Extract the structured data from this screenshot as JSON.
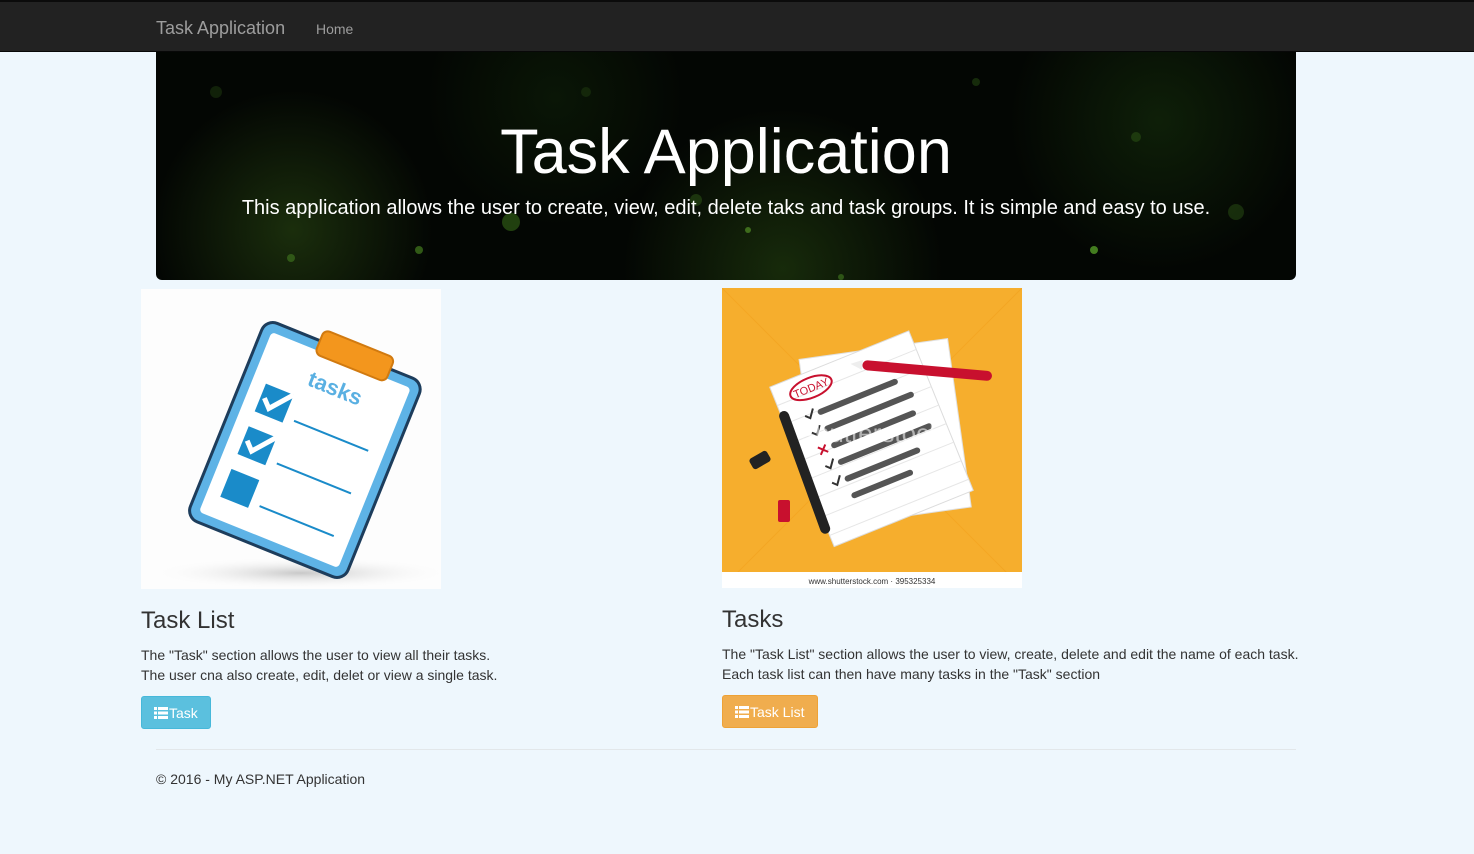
{
  "navbar": {
    "brand": "Task Application",
    "links": [
      {
        "label": "Home"
      }
    ]
  },
  "jumbotron": {
    "title": "Task Application",
    "lead": "This application allows the user to create, view, edit, delete taks and task groups. It is simple and easy to use."
  },
  "sections": [
    {
      "image_icon": "clipboard-tasks-illustration",
      "image_text": "tasks",
      "title": "Task List",
      "lines": [
        "The \"Task\" section allows the user to view all their tasks.",
        "The user cna also create, edit, delet or view a single task."
      ],
      "button_label": "Task",
      "button_icon": "list-icon",
      "button_color": "#5bc0de"
    },
    {
      "image_icon": "paper-checklist-illustration",
      "image_text": "TODAY",
      "image_watermark": "shutterstock",
      "image_caption": "www.shutterstock.com · 395325334",
      "title": "Tasks",
      "lines": [
        "The \"Task List\" section allows the user to view, create, delete and edit the name of each task.",
        "Each task list can then have many tasks in the \"Task\" section"
      ],
      "button_label": "Task List",
      "button_icon": "list-icon",
      "button_color": "#f0ad4e"
    }
  ],
  "footer": {
    "text": "© 2016 - My ASP.NET Application"
  },
  "colors": {
    "navbar_bg": "#222222",
    "page_bg": "#eef7fd",
    "info": "#5bc0de",
    "warning": "#f0ad4e",
    "tile_orange": "#f6ae2d"
  }
}
